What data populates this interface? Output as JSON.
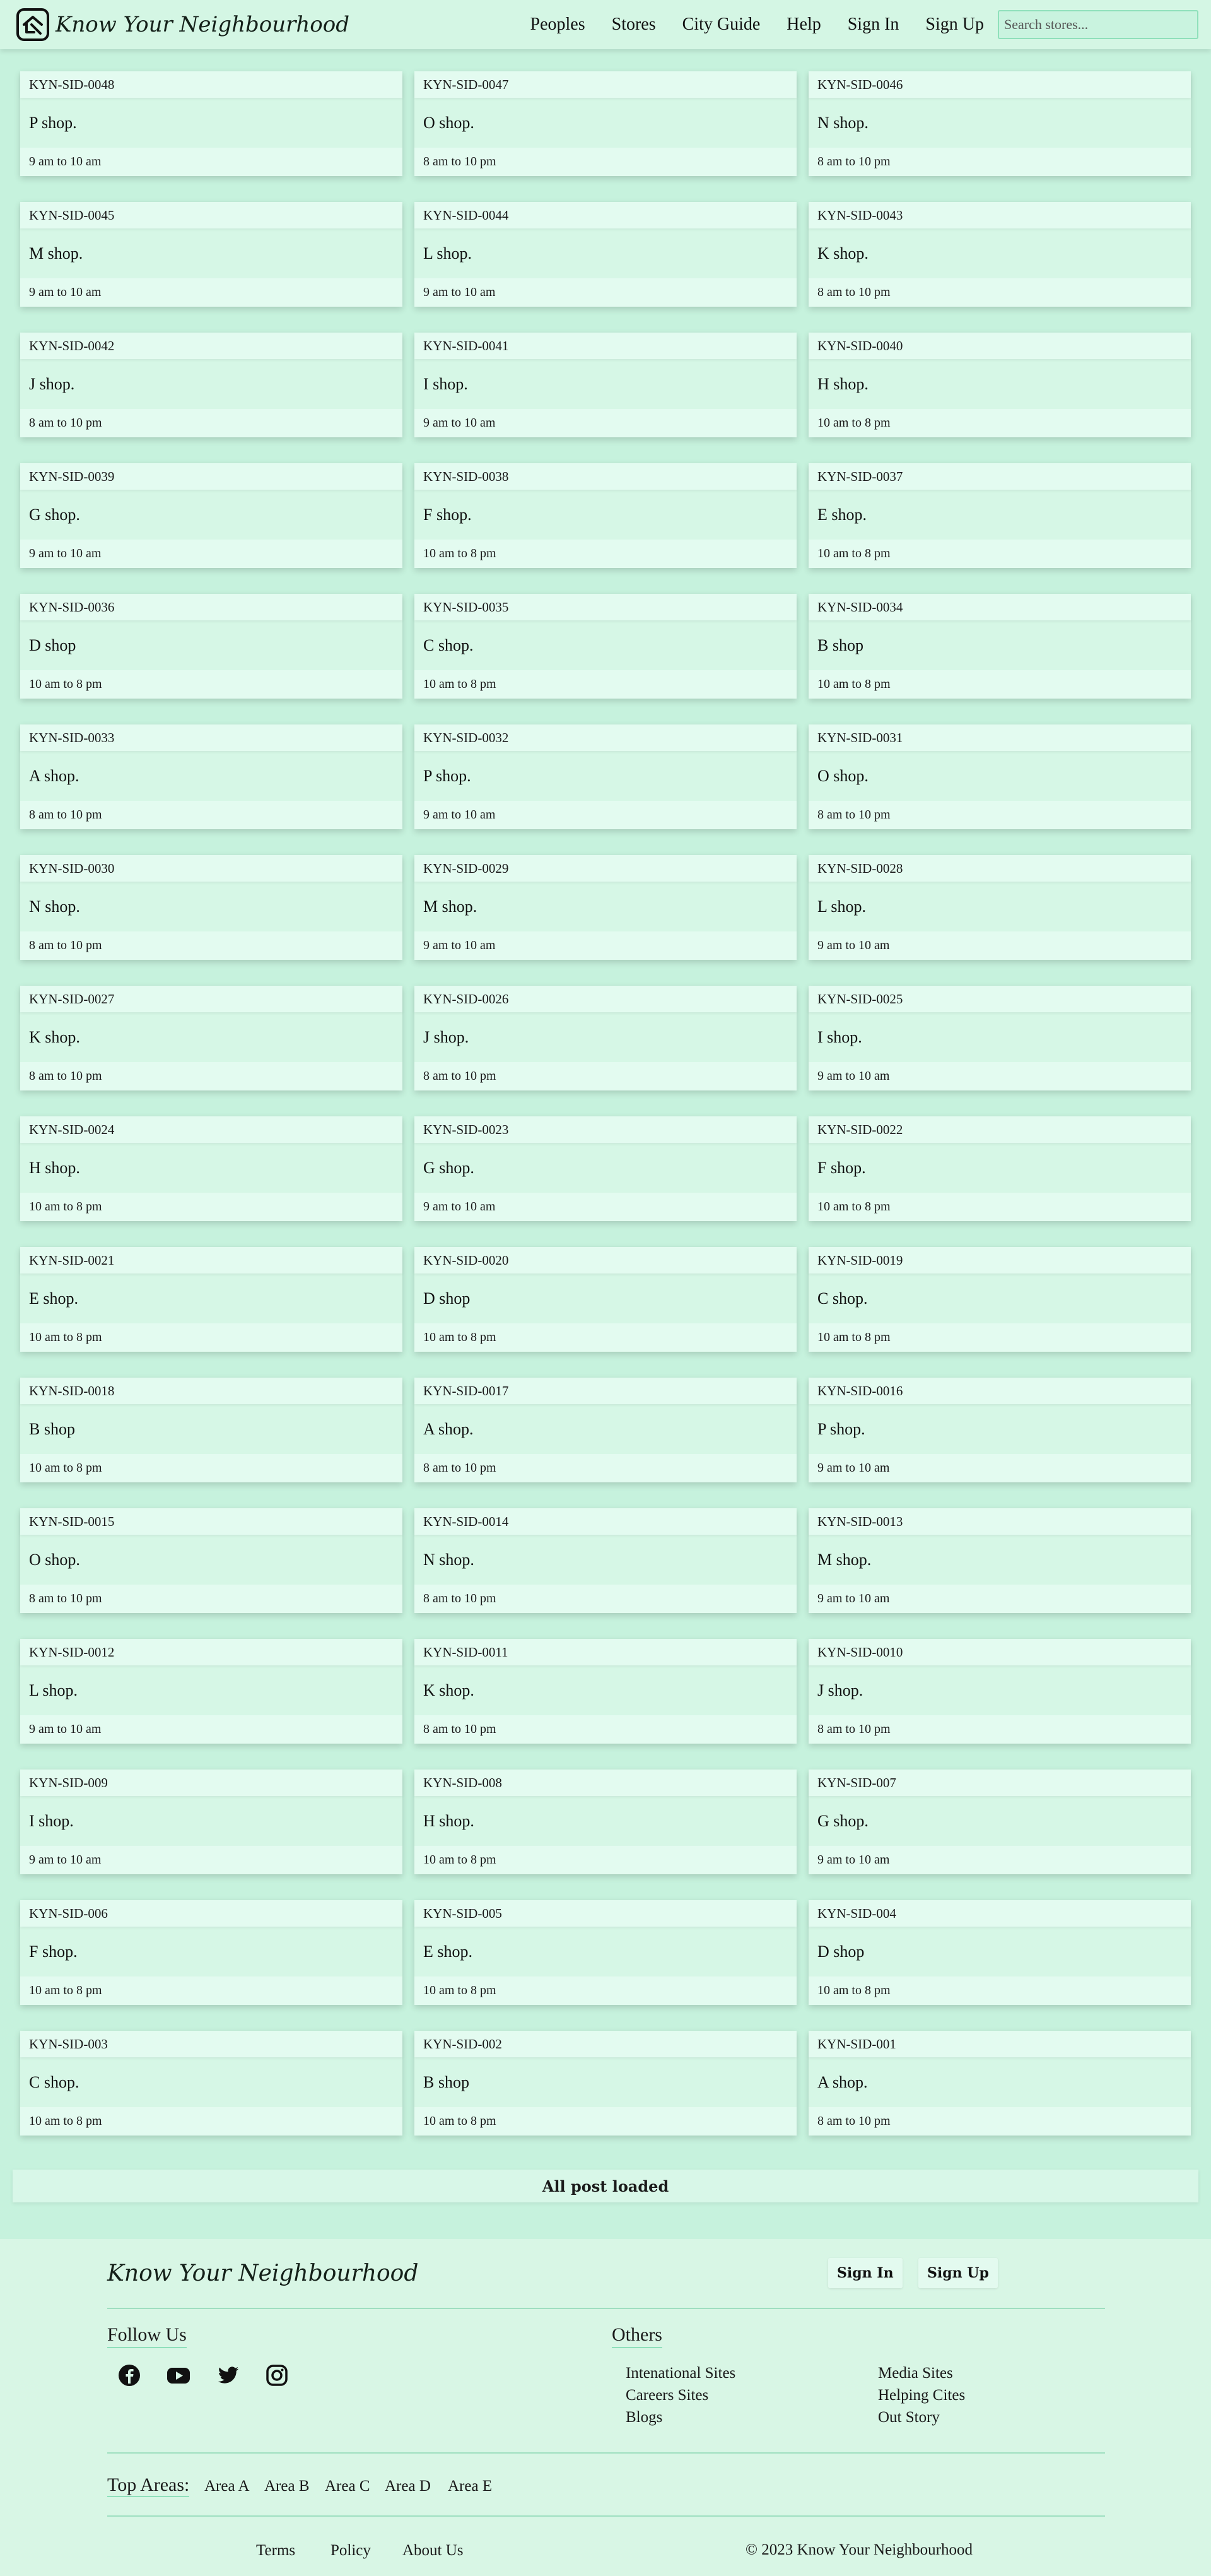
{
  "header": {
    "brand": "Know Your Neighbourhood",
    "nav": [
      "Peoples",
      "Stores",
      "City Guide",
      "Help",
      "Sign In",
      "Sign Up"
    ],
    "search_placeholder": "Search stores..."
  },
  "stores": [
    {
      "id": "KYN-SID-0048",
      "name": "P shop.",
      "hours": "9 am to 10 am"
    },
    {
      "id": "KYN-SID-0047",
      "name": "O shop.",
      "hours": "8 am to 10 pm"
    },
    {
      "id": "KYN-SID-0046",
      "name": "N shop.",
      "hours": "8 am to 10 pm"
    },
    {
      "id": "KYN-SID-0045",
      "name": "M shop.",
      "hours": "9 am to 10 am"
    },
    {
      "id": "KYN-SID-0044",
      "name": "L shop.",
      "hours": "9 am to 10 am"
    },
    {
      "id": "KYN-SID-0043",
      "name": "K shop.",
      "hours": "8 am to 10 pm"
    },
    {
      "id": "KYN-SID-0042",
      "name": "J shop.",
      "hours": "8 am to 10 pm"
    },
    {
      "id": "KYN-SID-0041",
      "name": "I shop.",
      "hours": "9 am to 10 am"
    },
    {
      "id": "KYN-SID-0040",
      "name": "H shop.",
      "hours": "10 am to 8 pm"
    },
    {
      "id": "KYN-SID-0039",
      "name": "G shop.",
      "hours": "9 am to 10 am"
    },
    {
      "id": "KYN-SID-0038",
      "name": "F shop.",
      "hours": "10 am to 8 pm"
    },
    {
      "id": "KYN-SID-0037",
      "name": "E shop.",
      "hours": "10 am to 8 pm"
    },
    {
      "id": "KYN-SID-0036",
      "name": "D shop",
      "hours": "10 am to 8 pm"
    },
    {
      "id": "KYN-SID-0035",
      "name": "C shop.",
      "hours": "10 am to 8 pm"
    },
    {
      "id": "KYN-SID-0034",
      "name": "B shop",
      "hours": "10 am to 8 pm"
    },
    {
      "id": "KYN-SID-0033",
      "name": "A shop.",
      "hours": "8 am to 10 pm"
    },
    {
      "id": "KYN-SID-0032",
      "name": "P shop.",
      "hours": "9 am to 10 am"
    },
    {
      "id": "KYN-SID-0031",
      "name": "O shop.",
      "hours": "8 am to 10 pm"
    },
    {
      "id": "KYN-SID-0030",
      "name": "N shop.",
      "hours": "8 am to 10 pm"
    },
    {
      "id": "KYN-SID-0029",
      "name": "M shop.",
      "hours": "9 am to 10 am"
    },
    {
      "id": "KYN-SID-0028",
      "name": "L shop.",
      "hours": "9 am to 10 am"
    },
    {
      "id": "KYN-SID-0027",
      "name": "K shop.",
      "hours": "8 am to 10 pm"
    },
    {
      "id": "KYN-SID-0026",
      "name": "J shop.",
      "hours": "8 am to 10 pm"
    },
    {
      "id": "KYN-SID-0025",
      "name": "I shop.",
      "hours": "9 am to 10 am"
    },
    {
      "id": "KYN-SID-0024",
      "name": "H shop.",
      "hours": "10 am to 8 pm"
    },
    {
      "id": "KYN-SID-0023",
      "name": "G shop.",
      "hours": "9 am to 10 am"
    },
    {
      "id": "KYN-SID-0022",
      "name": "F shop.",
      "hours": "10 am to 8 pm"
    },
    {
      "id": "KYN-SID-0021",
      "name": "E shop.",
      "hours": "10 am to 8 pm"
    },
    {
      "id": "KYN-SID-0020",
      "name": "D shop",
      "hours": "10 am to 8 pm"
    },
    {
      "id": "KYN-SID-0019",
      "name": "C shop.",
      "hours": "10 am to 8 pm"
    },
    {
      "id": "KYN-SID-0018",
      "name": "B shop",
      "hours": "10 am to 8 pm"
    },
    {
      "id": "KYN-SID-0017",
      "name": "A shop.",
      "hours": "8 am to 10 pm"
    },
    {
      "id": "KYN-SID-0016",
      "name": "P shop.",
      "hours": "9 am to 10 am"
    },
    {
      "id": "KYN-SID-0015",
      "name": "O shop.",
      "hours": "8 am to 10 pm"
    },
    {
      "id": "KYN-SID-0014",
      "name": "N shop.",
      "hours": "8 am to 10 pm"
    },
    {
      "id": "KYN-SID-0013",
      "name": "M shop.",
      "hours": "9 am to 10 am"
    },
    {
      "id": "KYN-SID-0012",
      "name": "L shop.",
      "hours": "9 am to 10 am"
    },
    {
      "id": "KYN-SID-0011",
      "name": "K shop.",
      "hours": "8 am to 10 pm"
    },
    {
      "id": "KYN-SID-0010",
      "name": "J shop.",
      "hours": "8 am to 10 pm"
    },
    {
      "id": "KYN-SID-009",
      "name": "I shop.",
      "hours": "9 am to 10 am"
    },
    {
      "id": "KYN-SID-008",
      "name": "H shop.",
      "hours": "10 am to 8 pm"
    },
    {
      "id": "KYN-SID-007",
      "name": "G shop.",
      "hours": "9 am to 10 am"
    },
    {
      "id": "KYN-SID-006",
      "name": "F shop.",
      "hours": "10 am to 8 pm"
    },
    {
      "id": "KYN-SID-005",
      "name": "E shop.",
      "hours": "10 am to 8 pm"
    },
    {
      "id": "KYN-SID-004",
      "name": "D shop",
      "hours": "10 am to 8 pm"
    },
    {
      "id": "KYN-SID-003",
      "name": "C shop.",
      "hours": "10 am to 8 pm"
    },
    {
      "id": "KYN-SID-002",
      "name": "B shop",
      "hours": "10 am to 8 pm"
    },
    {
      "id": "KYN-SID-001",
      "name": "A shop.",
      "hours": "8 am to 10 pm"
    }
  ],
  "status": {
    "all_loaded": "All post loaded"
  },
  "footer": {
    "brand": "Know Your Neighbourhood",
    "sign_in": "Sign In",
    "sign_up": "Sign Up",
    "follow_us": "Follow Us",
    "social_icons": [
      "facebook-icon",
      "youtube-icon",
      "twitter-icon",
      "instagram-icon"
    ],
    "others_heading": "Others",
    "others_links": [
      "Intenational Sites",
      "Careers Sites",
      "Blogs",
      "Media Sites",
      "Helping Cites",
      "Out Story"
    ],
    "top_areas_label": "Top Areas:",
    "areas": [
      "Area A",
      "Area B",
      "Area C",
      "Area D",
      "Area E"
    ],
    "bottom_links": [
      "Terms",
      "Policy",
      "About Us"
    ],
    "copyright": "© 2023 Know Your Neighbourhood"
  },
  "colors": {
    "page_bg": "#c6f2dd",
    "card_bg": "#d6f7e6",
    "card_band": "#e3fbf0",
    "accent": "#8fe0bb"
  }
}
